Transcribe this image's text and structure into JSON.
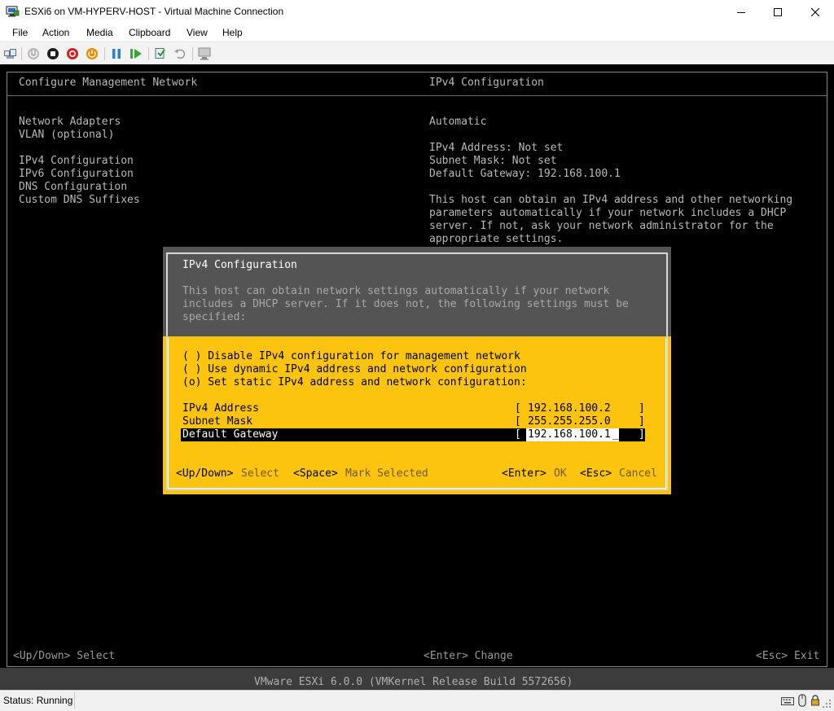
{
  "window": {
    "title": "ESXi6 on VM-HYPERV-HOST - Virtual Machine Connection"
  },
  "menu": [
    "File",
    "Action",
    "Media",
    "Clipboard",
    "View",
    "Help"
  ],
  "toolbar": {
    "icons": [
      "ctrl-alt-del-icon",
      "start-icon",
      "turn-off-icon",
      "shut-down-icon",
      "save-icon",
      "pause-icon",
      "resume-icon",
      "checkpoint-icon",
      "revert-icon",
      "enhanced-session-icon"
    ]
  },
  "console": {
    "left_header": "Configure Management Network",
    "right_header": "IPv4 Configuration",
    "menu_items": [
      "Network Adapters",
      "VLAN (optional)",
      "IPv4 Configuration",
      "IPv6 Configuration",
      "DNS Configuration",
      "Custom DNS Suffixes"
    ],
    "info": {
      "mode": "Automatic",
      "ipv4_address": "IPv4 Address: Not set",
      "subnet_mask": "Subnet Mask: Not set",
      "default_gateway": "Default Gateway: 192.168.100.1",
      "description": [
        "This host can obtain an IPv4 address and other networking",
        "parameters automatically if your network includes a DHCP",
        "server. If not, ask your network administrator for the",
        "appropriate settings."
      ]
    },
    "footer": {
      "select": "<Up/Down> Select",
      "change": "<Enter> Change",
      "exit": "<Esc> Exit"
    },
    "version": "VMware ESXi 6.0.0 (VMKernel Release Build 5572656)"
  },
  "dialog": {
    "title": "IPv4 Configuration",
    "description": [
      "This host can obtain network settings automatically if your network",
      "includes a DHCP server. If it does not, the following settings must be",
      "specified:"
    ],
    "options": [
      "( ) Disable IPv4 configuration for management network",
      "( ) Use dynamic IPv4 address and network configuration",
      "(o) Set static IPv4 address and network configuration:"
    ],
    "fields": [
      {
        "label": "IPv4 Address",
        "value": "192.168.100.2"
      },
      {
        "label": "Subnet Mask",
        "value": "255.255.255.0"
      },
      {
        "label": "Default Gateway",
        "value": "192.168.100.1"
      }
    ],
    "hints": {
      "updown_key": "<Up/Down>",
      "updown_label": "Select",
      "space_key": "<Space>",
      "space_label": "Mark Selected",
      "enter_key": "<Enter>",
      "enter_label": "OK",
      "esc_key": "<Esc>",
      "esc_label": "Cancel"
    },
    "bracket_open": "[",
    "bracket_close": "]",
    "cursor": "_"
  },
  "status": {
    "text": "Status: Running"
  },
  "colors": {
    "console_bg": "#000000",
    "console_text": "#b9b9b9",
    "dialog_yellow": "#fcc40f",
    "dialog_gray": "#545454"
  }
}
